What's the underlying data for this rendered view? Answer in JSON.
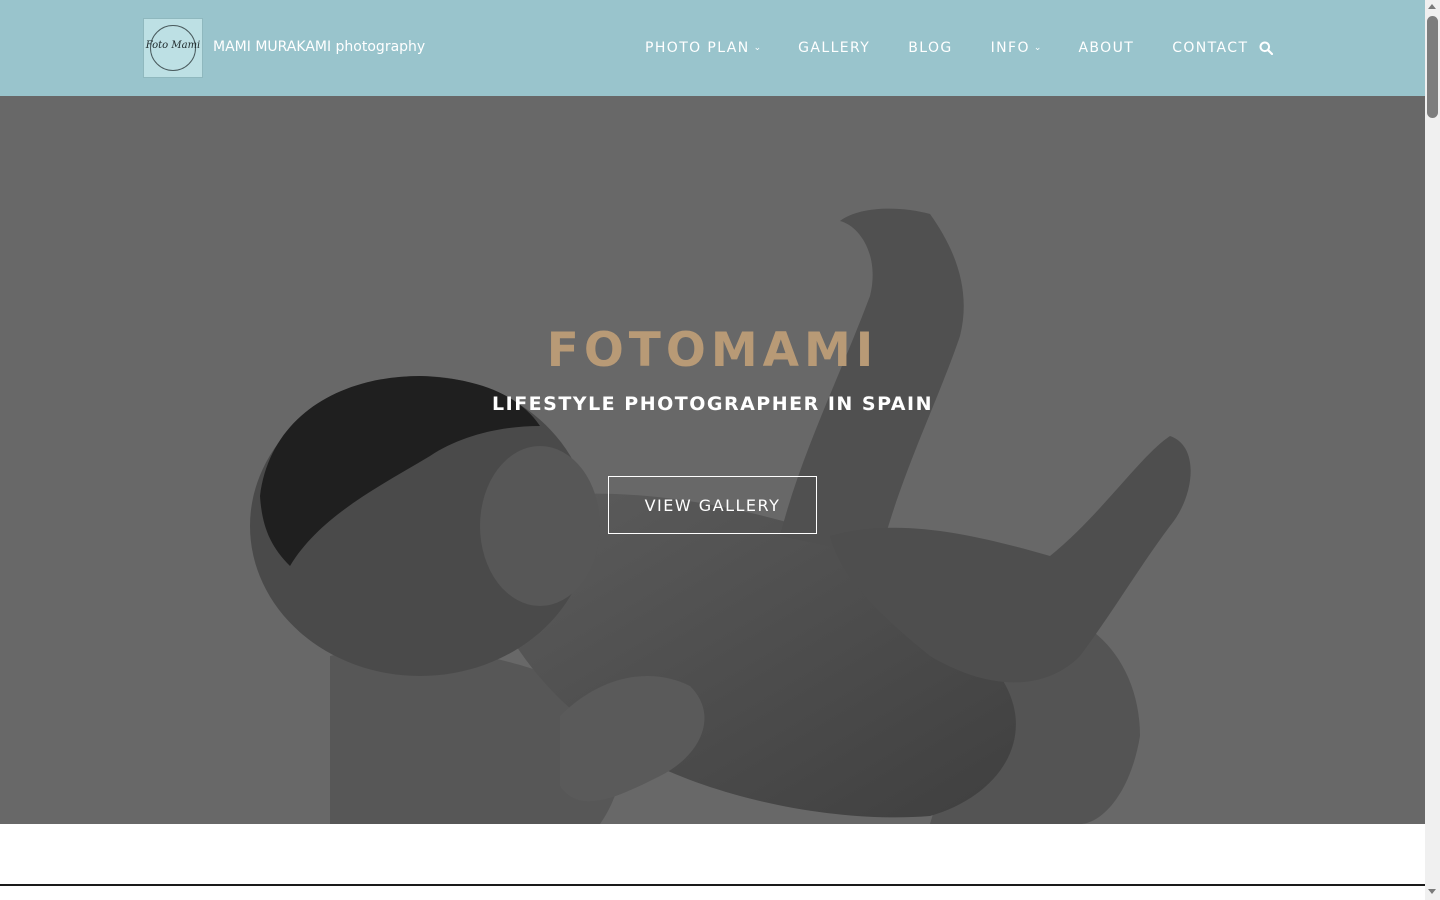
{
  "header": {
    "brand_name": "MAMI MURAKAMI photography",
    "logo_text": "Foto Mami",
    "background_color": "#99c4cc"
  },
  "nav": {
    "items": [
      {
        "label": "PHOTO PLAN",
        "has_dropdown": true
      },
      {
        "label": "GALLERY",
        "has_dropdown": false
      },
      {
        "label": "BLOG",
        "has_dropdown": false
      },
      {
        "label": "INFO",
        "has_dropdown": true
      },
      {
        "label": "ABOUT",
        "has_dropdown": false
      },
      {
        "label": "CONTACT",
        "has_dropdown": false
      }
    ],
    "dropdown_caret": "⌄",
    "search_icon": "search-icon"
  },
  "hero": {
    "title": "FOTOMAMI",
    "subtitle": "LIFESTYLE PHOTOGRAPHER IN SPAIN",
    "button_label": "VIEW GALLERY",
    "title_color": "#b89a76",
    "overlay_color": "#686868"
  }
}
